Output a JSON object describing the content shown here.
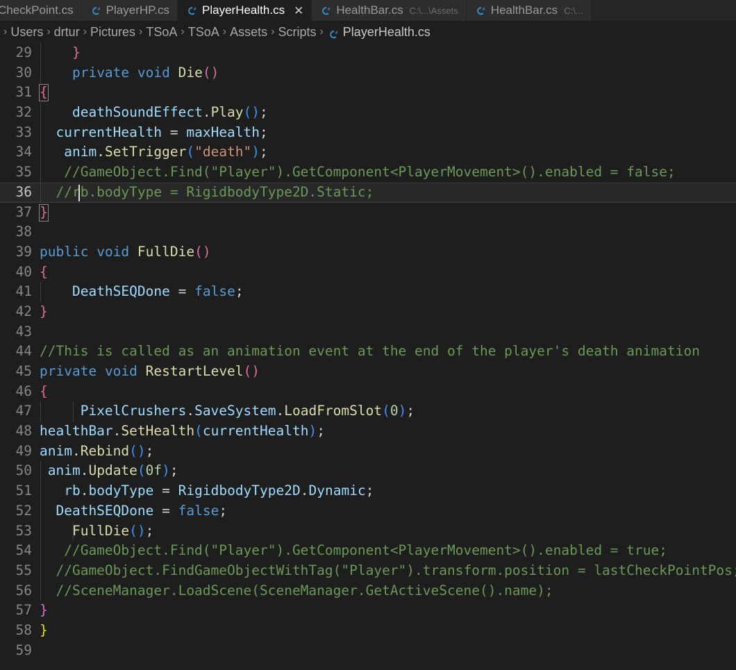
{
  "window": {
    "app": "Visual Studio Code",
    "theme_background": "#1e1e1e",
    "active_file": "PlayerHealth.cs"
  },
  "tabs": [
    {
      "label": "CheckPoint.cs",
      "path": "",
      "active": false,
      "icon": "csharp-file-icon",
      "closeable": false,
      "has_icon": false
    },
    {
      "label": "PlayerHP.cs",
      "path": "",
      "active": false,
      "icon": "csharp-file-icon",
      "closeable": false,
      "has_icon": true
    },
    {
      "label": "PlayerHealth.cs",
      "path": "",
      "active": true,
      "icon": "csharp-file-icon",
      "closeable": true,
      "has_icon": true,
      "close_glyph": "✕"
    },
    {
      "label": "HealthBar.cs",
      "path": "C:\\...\\Assets",
      "active": false,
      "icon": "csharp-file-icon",
      "closeable": false,
      "has_icon": true
    },
    {
      "label": "HealthBar.cs",
      "path": "C:\\...",
      "active": false,
      "icon": "csharp-file-icon",
      "closeable": false,
      "has_icon": true
    }
  ],
  "breadcrumb": {
    "separator": "›",
    "items": [
      "Users",
      "drtur",
      "Pictures",
      "TSoA",
      "TSoA",
      "Assets",
      "Scripts"
    ],
    "file": "PlayerHealth.cs",
    "file_icon": "csharp-file-icon"
  },
  "editor": {
    "language": "csharp",
    "current_line": 36,
    "cursor_column": 7,
    "first_visible_line": 29,
    "last_visible_line": 59,
    "lines": [
      {
        "n": 29,
        "text": "    }"
      },
      {
        "n": 30,
        "text": "    private void Die()"
      },
      {
        "n": 31,
        "text": "{"
      },
      {
        "n": 32,
        "text": "    deathSoundEffect.Play();"
      },
      {
        "n": 33,
        "text": "  currentHealth = maxHealth;"
      },
      {
        "n": 34,
        "text": "   anim.SetTrigger(\"death\");"
      },
      {
        "n": 35,
        "text": "   //GameObject.Find(\"Player\").GetComponent<PlayerMovement>().enabled = false;"
      },
      {
        "n": 36,
        "text": "  //rb.bodyType = RigidbodyType2D.Static;"
      },
      {
        "n": 37,
        "text": "}"
      },
      {
        "n": 38,
        "text": ""
      },
      {
        "n": 39,
        "text": "public void FullDie()"
      },
      {
        "n": 40,
        "text": "{"
      },
      {
        "n": 41,
        "text": "    DeathSEQDone = false;"
      },
      {
        "n": 42,
        "text": "}"
      },
      {
        "n": 43,
        "text": ""
      },
      {
        "n": 44,
        "text": "//This is called as an animation event at the end of the player's death animation"
      },
      {
        "n": 45,
        "text": "private void RestartLevel()"
      },
      {
        "n": 46,
        "text": "{"
      },
      {
        "n": 47,
        "text": "     PixelCrushers.SaveSystem.LoadFromSlot(0);"
      },
      {
        "n": 48,
        "text": "healthBar.SetHealth(currentHealth);"
      },
      {
        "n": 49,
        "text": "anim.Rebind();"
      },
      {
        "n": 50,
        "text": " anim.Update(0f);"
      },
      {
        "n": 51,
        "text": "   rb.bodyType = RigidbodyType2D.Dynamic;"
      },
      {
        "n": 52,
        "text": "  DeathSEQDone = false;"
      },
      {
        "n": 53,
        "text": "    FullDie();"
      },
      {
        "n": 54,
        "text": "   //GameObject.Find(\"Player\").GetComponent<PlayerMovement>().enabled = true;"
      },
      {
        "n": 55,
        "text": "  //GameObject.FindGameObjectWithTag(\"Player\").transform.position = lastCheckPointPos;"
      },
      {
        "n": 56,
        "text": "  //SceneManager.LoadScene(SceneManager.GetActiveScene().name);"
      },
      {
        "n": 57,
        "text": "}"
      },
      {
        "n": 58,
        "text": "}"
      },
      {
        "n": 59,
        "text": ""
      }
    ]
  },
  "colors": {
    "background": "#1e1e1e",
    "tabbar_background": "#252526",
    "inactive_tab": "#2d2d2d",
    "line_number": "#868686",
    "keyword": "#569cd6",
    "method": "#dcdcaa",
    "variable": "#9cdcfe",
    "string": "#ce9178",
    "number": "#b5cea8",
    "comment": "#6a9955",
    "bracket_pink": "#e06c9f",
    "bracket_yellow": "#e5e510",
    "bracket_blue": "#3f92f5"
  }
}
